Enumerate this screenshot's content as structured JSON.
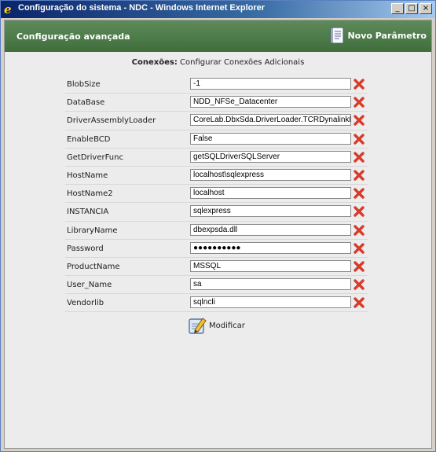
{
  "window": {
    "title": "Configuração do sistema - NDC - Windows Internet Explorer",
    "minimize_label": "_",
    "maximize_label": "□",
    "close_label": "×"
  },
  "header": {
    "title": "Configuração avançada",
    "new_param_label": "Novo Parâmetro"
  },
  "heading": {
    "bold": "Conexões:",
    "text": " Configurar Conexões Adicionais"
  },
  "params": [
    {
      "label": "BlobSize",
      "value": "-1"
    },
    {
      "label": "DataBase",
      "value": "NDD_NFSe_Datacenter"
    },
    {
      "label": "DriverAssemblyLoader",
      "value": "CoreLab.DbxSda.DriverLoader.TCRDynalinkDri"
    },
    {
      "label": "EnableBCD",
      "value": "False"
    },
    {
      "label": "GetDriverFunc",
      "value": "getSQLDriverSQLServer"
    },
    {
      "label": "HostName",
      "value": "localhost\\sqlexpress"
    },
    {
      "label": "HostName2",
      "value": "localhost"
    },
    {
      "label": "INSTANCIA",
      "value": "sqlexpress"
    },
    {
      "label": "LibraryName",
      "value": "dbexpsda.dll"
    },
    {
      "label": "Password",
      "value": "●●●●●●●●●●"
    },
    {
      "label": "ProductName",
      "value": "MSSQL"
    },
    {
      "label": "User_Name",
      "value": "sa"
    },
    {
      "label": "Vendorlib",
      "value": "sqlncli"
    }
  ],
  "modify_label": "Modificar",
  "colors": {
    "header_green": "#4a7a46",
    "delete_red": "#d93a2b"
  }
}
